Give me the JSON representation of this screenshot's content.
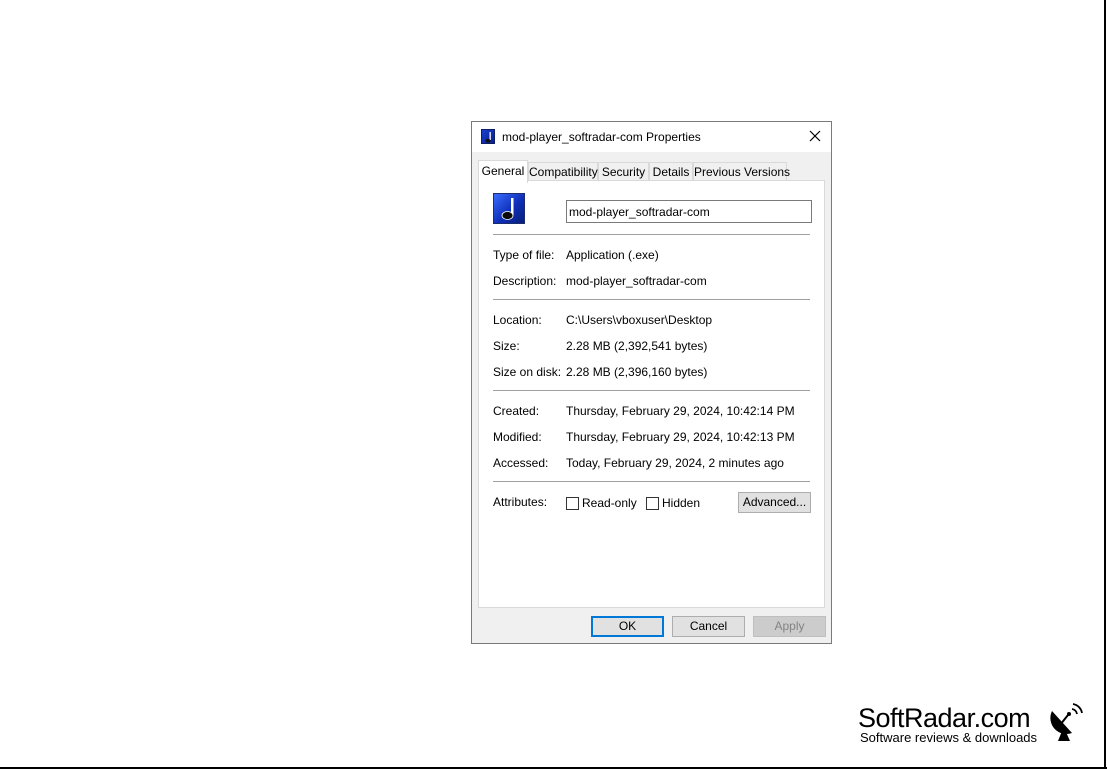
{
  "dialog": {
    "title": "mod-player_softradar-com Properties",
    "icon": "music-note-icon",
    "tabs": [
      "General",
      "Compatibility",
      "Security",
      "Details",
      "Previous Versions"
    ],
    "active_tab": "General",
    "file_name": "mod-player_softradar-com",
    "fields": {
      "type_label": "Type of file:",
      "type_value": "Application (.exe)",
      "description_label": "Description:",
      "description_value": "mod-player_softradar-com",
      "location_label": "Location:",
      "location_value": "C:\\Users\\vboxuser\\Desktop",
      "size_label": "Size:",
      "size_value": "2.28 MB (2,392,541 bytes)",
      "size_on_disk_label": "Size on disk:",
      "size_on_disk_value": "2.28 MB (2,396,160 bytes)",
      "created_label": "Created:",
      "created_value": "Thursday, February 29, 2024, 10:42:14 PM",
      "modified_label": "Modified:",
      "modified_value": "Thursday, February 29, 2024, 10:42:13 PM",
      "accessed_label": "Accessed:",
      "accessed_value": "Today, February 29, 2024, 2 minutes ago",
      "attributes_label": "Attributes:"
    },
    "attributes": {
      "readonly_label": "Read-only",
      "readonly_checked": false,
      "hidden_label": "Hidden",
      "hidden_checked": false,
      "advanced_label": "Advanced..."
    },
    "buttons": {
      "ok": "OK",
      "cancel": "Cancel",
      "apply": "Apply"
    }
  },
  "watermark": {
    "name": "SoftRadar.com",
    "tagline": "Software reviews & downloads",
    "icon": "satellite-dish-icon"
  },
  "colors": {
    "focus": "#0078d7",
    "icon_blue": "#1a3fd0"
  }
}
